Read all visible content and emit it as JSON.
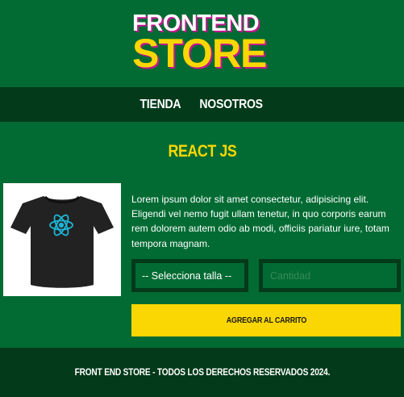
{
  "header": {
    "logo_line1": "FRONTEND",
    "logo_line2": "STORE"
  },
  "nav": {
    "items": [
      {
        "label": "TIENDA"
      },
      {
        "label": "NOSOTROS"
      }
    ]
  },
  "product": {
    "title": "REACT JS",
    "image_icon": "react-logo-tshirt",
    "description": "Lorem ipsum dolor sit amet consectetur, adipisicing elit. Eligendi vel nemo fugit ullam tenetur, in quo corporis earum rem dolorem autem odio ab modi, officiis pariatur iure, totam tempora magnam.",
    "size_select": "-- Selecciona talla --",
    "quantity_placeholder": "Cantidad",
    "add_button": "AGREGAR AL CARRITO"
  },
  "footer": {
    "text": "FRONT END STORE - TODOS LOS DERECHOS RESERVADOS 2024."
  },
  "colors": {
    "background": "#026b33",
    "dark": "#023a1a",
    "accent": "#fad702",
    "logo_shadow": "#c2178f"
  }
}
